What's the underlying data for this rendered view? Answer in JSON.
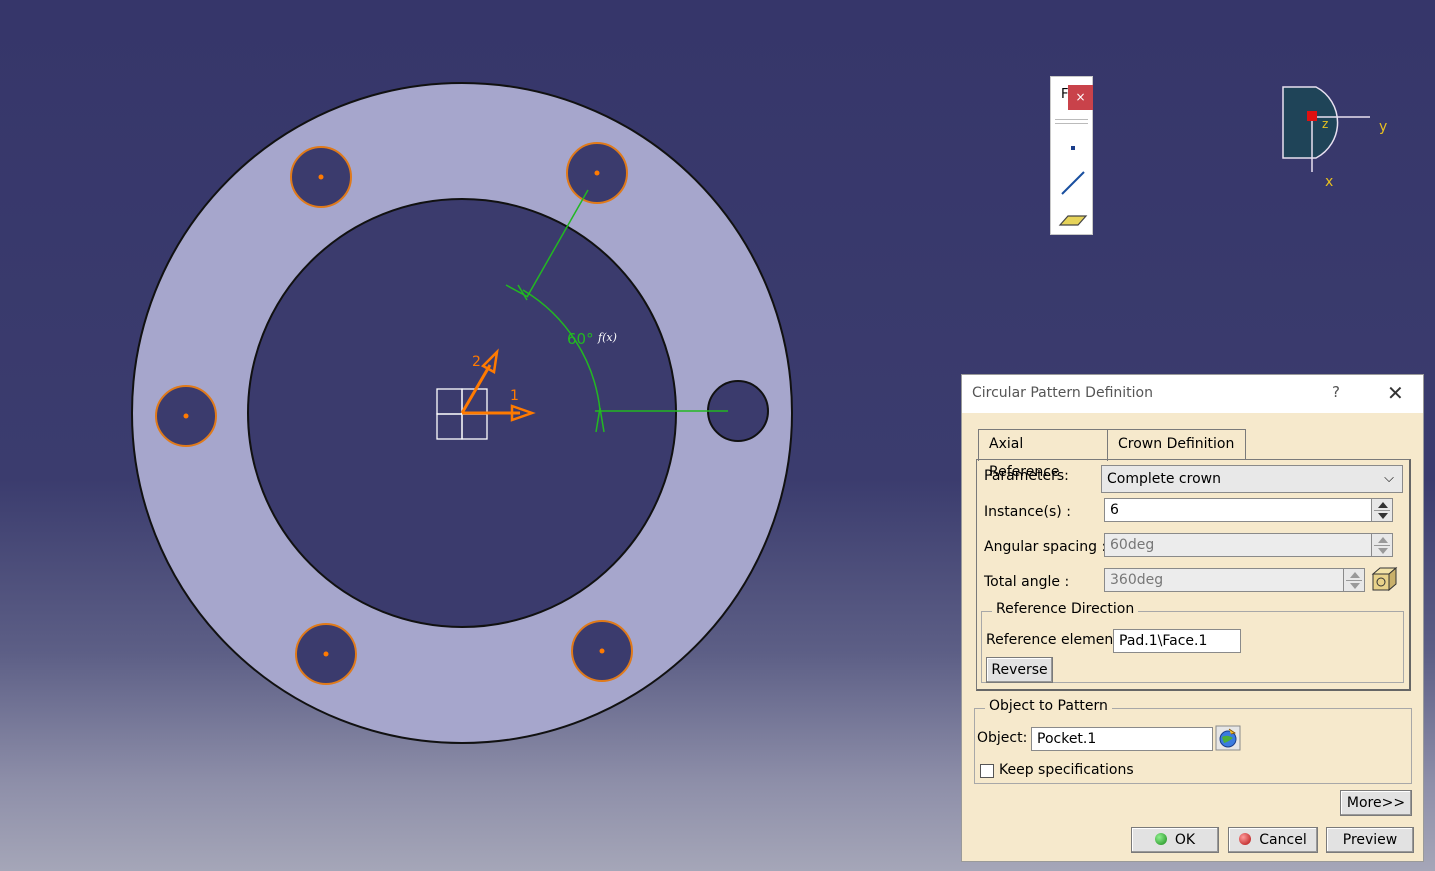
{
  "viewport": {
    "angle_label": "60°",
    "formula_icon": "f(x)",
    "axis_label_1": "1",
    "axis_label_2": "2",
    "compass": {
      "x_label": "x",
      "y_label": "y",
      "z_label": "z"
    },
    "colors": {
      "hole_outline": "#e07a1a",
      "center_point": "#ff7a00",
      "dimension": "#22b822",
      "part_face": "#a6a6cc"
    }
  },
  "mini_toolbar": {
    "title": "F",
    "close_label": "×",
    "tools": [
      "point-icon",
      "line-icon",
      "plane-icon"
    ]
  },
  "dialog": {
    "title": "Circular Pattern Definition",
    "help_label": "?",
    "close_label": "✕",
    "tabs": [
      {
        "label": "Axial Reference",
        "active": true
      },
      {
        "label": "Crown Definition",
        "active": false
      }
    ],
    "parameters": {
      "label": "Parameters:",
      "value": "Complete crown"
    },
    "instances": {
      "label": "Instance(s) :",
      "value": "6"
    },
    "angular_spacing": {
      "label": "Angular spacing :",
      "value": "60deg"
    },
    "total_angle": {
      "label": "Total angle :",
      "value": "360deg"
    },
    "reference_direction": {
      "legend": "Reference Direction",
      "element_label": "Reference element:",
      "element_value": "Pad.1\\Face.1",
      "reverse_label": "Reverse"
    },
    "object_to_pattern": {
      "legend": "Object to Pattern",
      "object_label": "Object:",
      "object_value": "Pocket.1",
      "keep_spec_label": "Keep specifications",
      "keep_spec_checked": false
    },
    "buttons": {
      "more": "More>>",
      "ok": "OK",
      "cancel": "Cancel",
      "preview": "Preview"
    }
  }
}
